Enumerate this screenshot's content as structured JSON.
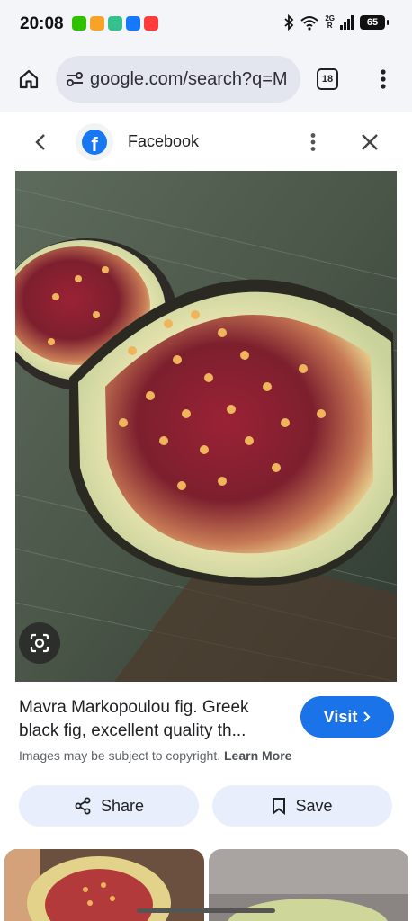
{
  "status_bar": {
    "time": "20:08",
    "network_label": "2G",
    "network_sub": "R",
    "battery": "65",
    "notification_icons": [
      "wechat-icon",
      "app-icon",
      "download-icon",
      "alipay-icon",
      "shop-icon"
    ]
  },
  "toolbar": {
    "url": "google.com/search?q=M",
    "tab_count": "18"
  },
  "panel": {
    "site_name": "Facebook",
    "logo_letter": "f"
  },
  "result": {
    "title_line1": "Mavra Markopoulou fig. Greek",
    "title_line2": "black fig, excellent quality th...",
    "visit_label": "Visit",
    "copyright_text": "Images may be subject to copyright.",
    "learn_more": "Learn More",
    "share_label": "Share",
    "save_label": "Save"
  },
  "colors": {
    "accent": "#1a73e8",
    "facebook": "#1877f2",
    "chip_bg": "#e8eefb"
  }
}
